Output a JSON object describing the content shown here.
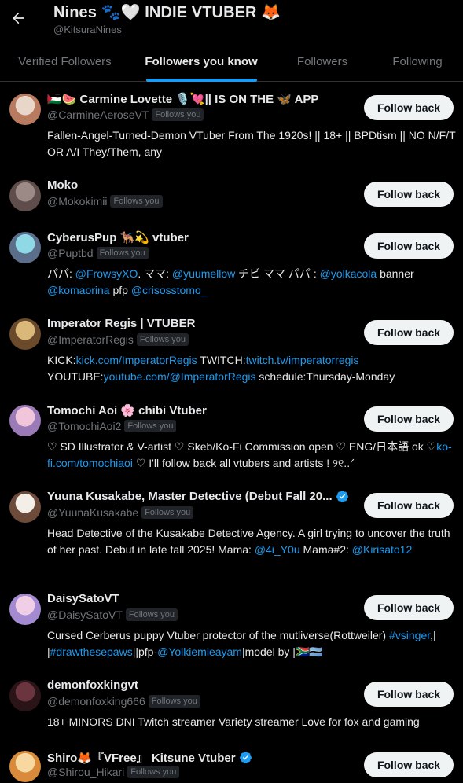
{
  "header": {
    "title": "Nines 🐾🤍 INDIE VTUBER 🦊",
    "handle": "@KitsuraNines"
  },
  "tabs": [
    {
      "label": "Verified Followers",
      "active": false
    },
    {
      "label": "Followers you know",
      "active": true
    },
    {
      "label": "Followers",
      "active": false
    },
    {
      "label": "Following",
      "active": false
    }
  ],
  "follows_you_label": "Follows you",
  "follow_back_label": "Follow back",
  "users": [
    {
      "name": "🇵🇸🍉 Carmine Lovette 🎙️💘|| IS ON THE 🦋 APP",
      "handle": "@CarmineAeroseVT",
      "verified": false,
      "bio": [
        {
          "t": "Fallen-Angel-Turned-Demon VTuber From The 1920s! || 18+ || BPDtism || NO N/F/T OR A/I They/Them, any"
        }
      ]
    },
    {
      "name": "Moko",
      "handle": "@Mokokimii",
      "verified": false,
      "bio": []
    },
    {
      "name": "CyberusPup 🐕‍🦺💫 vtuber",
      "handle": "@Puptbd",
      "verified": false,
      "bio": [
        {
          "t": "パパ: "
        },
        {
          "t": "@FrowsyXO",
          "link": true
        },
        {
          "t": ". ママ: "
        },
        {
          "t": "@yuumellow",
          "link": true
        },
        {
          "t": " チビ ママ パパ : "
        },
        {
          "t": "@yolkacola",
          "link": true
        },
        {
          "t": " banner "
        },
        {
          "t": "@komaorina",
          "link": true
        },
        {
          "t": " pfp "
        },
        {
          "t": "@crisosstomo_",
          "link": true
        }
      ]
    },
    {
      "name": "Imperator Regis | VTUBER",
      "handle": "@ImperatorRegis",
      "verified": false,
      "bio": [
        {
          "t": "KICK:"
        },
        {
          "t": "kick.com/ImperatorRegis",
          "link": true
        },
        {
          "t": " TWITCH:"
        },
        {
          "t": "twitch.tv/imperatorregis",
          "link": true
        },
        {
          "t": " YOUTUBE:"
        },
        {
          "t": "youtube.com/@ImperatorRegis",
          "link": true
        },
        {
          "t": " schedule:Thursday-Monday"
        }
      ]
    },
    {
      "name": "Tomochi Aoi 🌸 chibi Vtuber",
      "handle": "@TomochiAoi2",
      "verified": false,
      "bio": [
        {
          "t": "♡ SD Illustrator & V-artist ♡ Skeb/Ko-Fi Commission open ♡ ENG/日本語 ok ♡"
        },
        {
          "t": "ko-fi.com/tomochiaoi",
          "link": true
        },
        {
          "t": " ♡ I'll follow back all vtubers and artists ! ୨୧..ᐟ"
        }
      ]
    },
    {
      "name": "Yuuna Kusakabe, Master Detective (Debut Fall 20...",
      "handle": "@YuunaKusakabe",
      "verified": true,
      "bio": [
        {
          "t": "Head Detective of the Kusakabe Detective Agency. A girl trying to uncover the truth of her past. Debut in late fall 2025! Mama: "
        },
        {
          "t": "@4i_Y0u",
          "link": true
        },
        {
          "t": " Mama#2: "
        },
        {
          "t": "@Kirisato12",
          "link": true
        }
      ]
    },
    {
      "name": "DaisySatoVT",
      "handle": "@DaisySatoVT",
      "verified": false,
      "bio": [
        {
          "t": "Cursed Cerberus puppy Vtuber protector of the mutliverse(Rottweiler) "
        },
        {
          "t": "#vsinger",
          "link": true
        },
        {
          "t": ",| |"
        },
        {
          "t": "#drawthesepaws",
          "link": true
        },
        {
          "t": "||pfp-"
        },
        {
          "t": "@Yolkiemieayam",
          "link": true
        },
        {
          "t": "|model by |🇿🇦🇧🇼"
        }
      ]
    },
    {
      "name": "demonfoxkingvt",
      "handle": "@demonfoxking666",
      "verified": false,
      "bio": [
        {
          "t": "18+ MINORS DNI Twitch streamer Variety streamer Love for fox and gaming"
        }
      ]
    },
    {
      "name": "Shiro🦊『VFree』 Kitsune Vtuber",
      "handle": "@Shirou_Hikari",
      "verified": true,
      "bio": []
    }
  ],
  "colors": {
    "background": "#000000",
    "accent": "#1d9bf0",
    "text": "#e7e9ea",
    "muted": "#71767b",
    "button_bg": "#eff3f4"
  }
}
